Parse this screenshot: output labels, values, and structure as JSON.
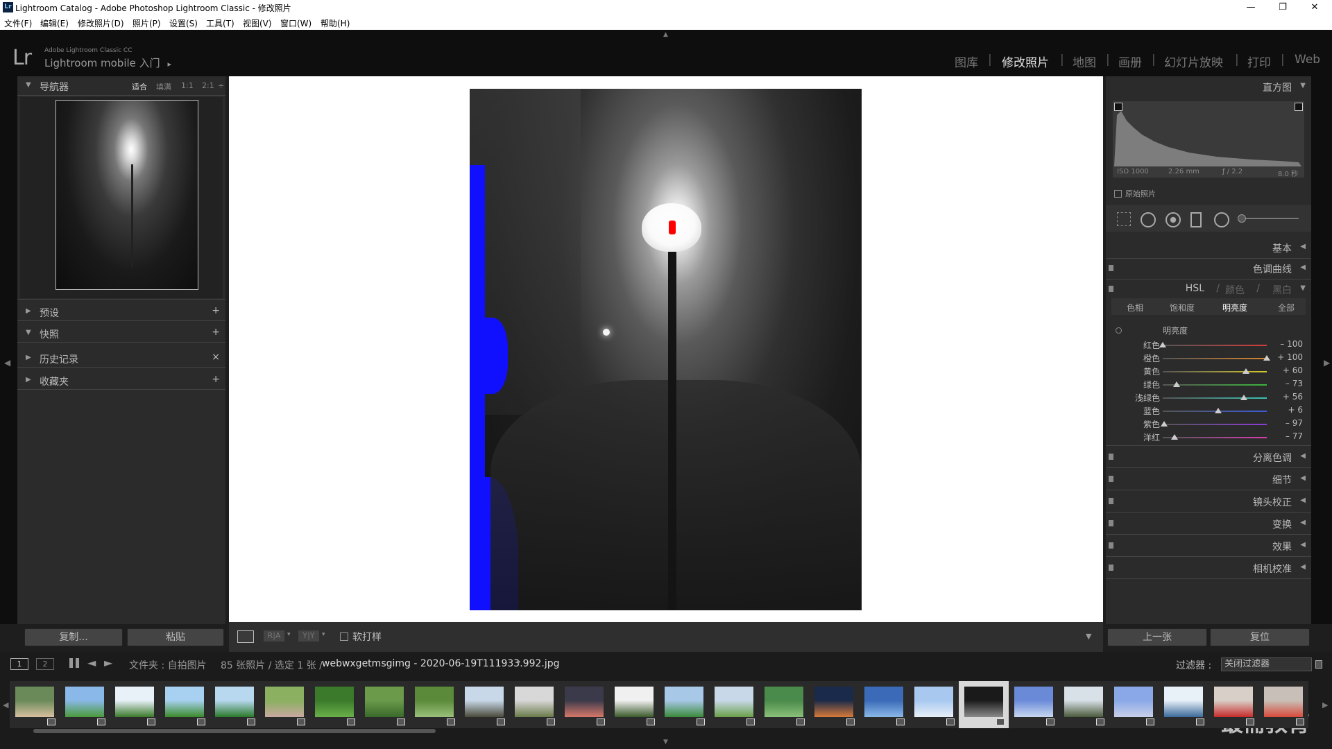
{
  "window": {
    "title": "Lightroom Catalog - Adobe Photoshop Lightroom Classic - 修改照片",
    "app_icon": "Lr",
    "controls": {
      "min": "—",
      "restore": "❐",
      "close": "✕"
    }
  },
  "menu": [
    "文件(F)",
    "编辑(E)",
    "修改照片(D)",
    "照片(P)",
    "设置(S)",
    "工具(T)",
    "视图(V)",
    "窗口(W)",
    "帮助(H)"
  ],
  "identity": {
    "logo": "Lr",
    "line1": "Adobe Lightroom Classic CC",
    "line2": "Lightroom mobile 入门",
    "arrow": "▸"
  },
  "modules": {
    "items": [
      "图库",
      "修改照片",
      "地图",
      "画册",
      "幻灯片放映",
      "打印",
      "Web"
    ],
    "active": "修改照片",
    "separator": "|"
  },
  "navigator": {
    "title": "导航器",
    "zoom_options": [
      "适合",
      "填满",
      "1:1",
      "2:1"
    ],
    "zoom_more": "÷"
  },
  "left_panels": [
    {
      "label": "预设",
      "action": "+",
      "collapsed": true
    },
    {
      "label": "快照",
      "action": "+",
      "collapsed": false
    },
    {
      "label": "历史记录",
      "action": "×",
      "collapsed": true
    },
    {
      "label": "收藏夹",
      "action": "+",
      "collapsed": true
    }
  ],
  "left_buttons": {
    "copy": "复制...",
    "paste": "粘贴"
  },
  "toolbar": {
    "soft_proof": "软打样",
    "view_ra": "R|A",
    "view_yy": "Y|Y"
  },
  "histogram": {
    "title": "直方图",
    "iso": "ISO 1000",
    "focal": "2.26 mm",
    "aperture": "ƒ / 2.2",
    "shutter": "8.0 秒",
    "original": "原始照片"
  },
  "right_sections_top": [
    {
      "label": "基本"
    },
    {
      "label": "色调曲线"
    }
  ],
  "hsl": {
    "title_hsl": "HSL",
    "title_color": "颜色",
    "title_bw": "黑白",
    "slash": "/",
    "tabs": [
      "色相",
      "饱和度",
      "明亮度",
      "全部"
    ],
    "active_tab": "明亮度",
    "subtitle": "明亮度",
    "sliders": [
      {
        "name": "红色",
        "value": "– 100",
        "num": -100,
        "color": "#d23c3c"
      },
      {
        "name": "橙色",
        "value": "+ 100",
        "num": 100,
        "color": "#d8842c"
      },
      {
        "name": "黄色",
        "value": "+ 60",
        "num": 60,
        "color": "#d8cc2c"
      },
      {
        "name": "绿色",
        "value": "– 73",
        "num": -73,
        "color": "#3cb43c"
      },
      {
        "name": "浅绿色",
        "value": "+ 56",
        "num": 56,
        "color": "#3cc4b4"
      },
      {
        "name": "蓝色",
        "value": "+ 6",
        "num": 6,
        "color": "#3c5cd8"
      },
      {
        "name": "紫色",
        "value": "– 97",
        "num": -97,
        "color": "#8c3cd8"
      },
      {
        "name": "洋红",
        "value": "– 77",
        "num": -77,
        "color": "#d83cb4"
      }
    ]
  },
  "right_sections_bottom": [
    {
      "label": "分离色调"
    },
    {
      "label": "细节"
    },
    {
      "label": "镜头校正"
    },
    {
      "label": "变换"
    },
    {
      "label": "效果"
    },
    {
      "label": "相机校准"
    }
  ],
  "right_buttons": {
    "prev": "上一张",
    "reset": "复位"
  },
  "filmstrip": {
    "page1": "1",
    "page2": "2",
    "source": "文件夹 : 自拍图片",
    "count": "85 张照片 / 选定 1 张 /",
    "filename": "webwxgetmsgimg - 2020-06-19T111933.992.jpg",
    "filter_label": "过滤器 :",
    "filter_value": "关闭过滤器",
    "thumbs": [
      {
        "c1": "#6a8a5a",
        "c2": "#d8c0a0"
      },
      {
        "c1": "#8ab8e8",
        "c2": "#4a9a3a"
      },
      {
        "c1": "#e8f0f8",
        "c2": "#3a7a2a"
      },
      {
        "c1": "#a8d0f0",
        "c2": "#3a8a2a"
      },
      {
        "c1": "#b8d8f0",
        "c2": "#2a7a2a"
      },
      {
        "c1": "#8ab060",
        "c2": "#c8a8a0"
      },
      {
        "c1": "#3a7a2a",
        "c2": "#6ab04a"
      },
      {
        "c1": "#6a9a4a",
        "c2": "#3a6a2a"
      },
      {
        "c1": "#5a8a3a",
        "c2": "#9ac07a"
      },
      {
        "c1": "#c8d8e8",
        "c2": "#4a4a3a"
      },
      {
        "c1": "#d8d8d8",
        "c2": "#6a7a4a"
      },
      {
        "c1": "#3a3a4a",
        "c2": "#d8786a"
      },
      {
        "c1": "#f0f0f0",
        "c2": "#3a5a2a"
      },
      {
        "c1": "#a8c8e8",
        "c2": "#3a8a3a"
      },
      {
        "c1": "#c8d8e8",
        "c2": "#6aa04a"
      },
      {
        "c1": "#4a8a4a",
        "c2": "#8ac07a"
      },
      {
        "c1": "#1a2a4a",
        "c2": "#d87a3a"
      },
      {
        "c1": "#3a6ab8",
        "c2": "#8ab8e8"
      },
      {
        "c1": "#a8c8f0",
        "c2": "#e8f0f8"
      },
      {
        "c1": "#1a1a1a",
        "c2": "#8a8a8a"
      },
      {
        "c1": "#6a8ad8",
        "c2": "#c8d8f0"
      },
      {
        "c1": "#d8e0e8",
        "c2": "#4a5a3a"
      },
      {
        "c1": "#8aa8e8",
        "c2": "#c8d0e8"
      },
      {
        "c1": "#e8f0f8",
        "c2": "#3a6a9a"
      },
      {
        "c1": "#d8d0c8",
        "c2": "#c82a2a"
      },
      {
        "c1": "#c8c0b8",
        "c2": "#d84a3a"
      }
    ]
  },
  "watermark": "最需教育",
  "colors": {
    "accent_active": "#e0e0e0",
    "panel": "#2b2b2b",
    "dark": "#0e0e0e"
  }
}
